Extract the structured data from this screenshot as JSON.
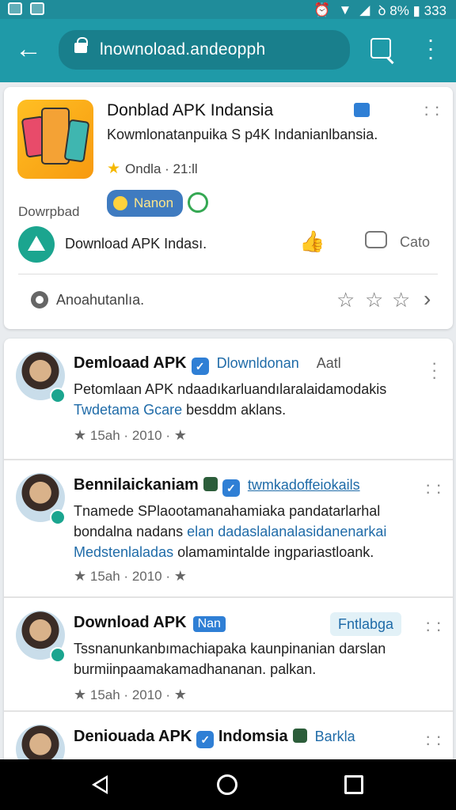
{
  "statusbar": {
    "right_text": "ꝺ 8% ▮ 333"
  },
  "browser": {
    "url": "lnownoload.andeopph"
  },
  "app_card": {
    "title": "Donblad APK Indansia",
    "subtitle": "Kowmlonatanpuika S p4K Indanianlbansia.",
    "rating": "Ondla · 21:ll",
    "download_label": "Dowrpbad",
    "nation_label": "Nanon",
    "brand_name": "Download APK Indası.",
    "comment_label": "Cato",
    "search_label": "Anoahutanlıa."
  },
  "posts": [
    {
      "name": "Demloaad APK",
      "tag": "Dlownldonan",
      "tag2": "Aatl",
      "line1": "Petomlaan APK ndaadıkarluandılaralaidamodakis",
      "line2a": "Twdetama",
      "line2b": "Gcare",
      "line2c": "besddm aklans.",
      "meta_time": "15ah",
      "meta_count": "2010"
    },
    {
      "name": "Bennilaickaniam",
      "tag": "twmkadoffeiokails",
      "line1": "Tnamede SPlaootamanahamiaka pandatarlarhal",
      "line2": "bondalna nadans",
      "line2b": "elan dadaslalanalasidanenarkai",
      "line3a": "Medstenlaladas",
      "line3b": "olamamintalde ingpariastloank.",
      "meta_time": "15ah",
      "meta_count": "2010"
    },
    {
      "name": "Download APK",
      "tag": "Nan",
      "pill": "Fntlabga",
      "line1": "Tssnanunkanbımachiapaka kaunpinanian darslan",
      "line2": "burmiinpaamakamadhananan. palkan.",
      "meta_time": "15ah",
      "meta_count": "2010"
    },
    {
      "name": "Deniouada APK",
      "name2": "Indomsia",
      "tag": "Barkla"
    }
  ]
}
